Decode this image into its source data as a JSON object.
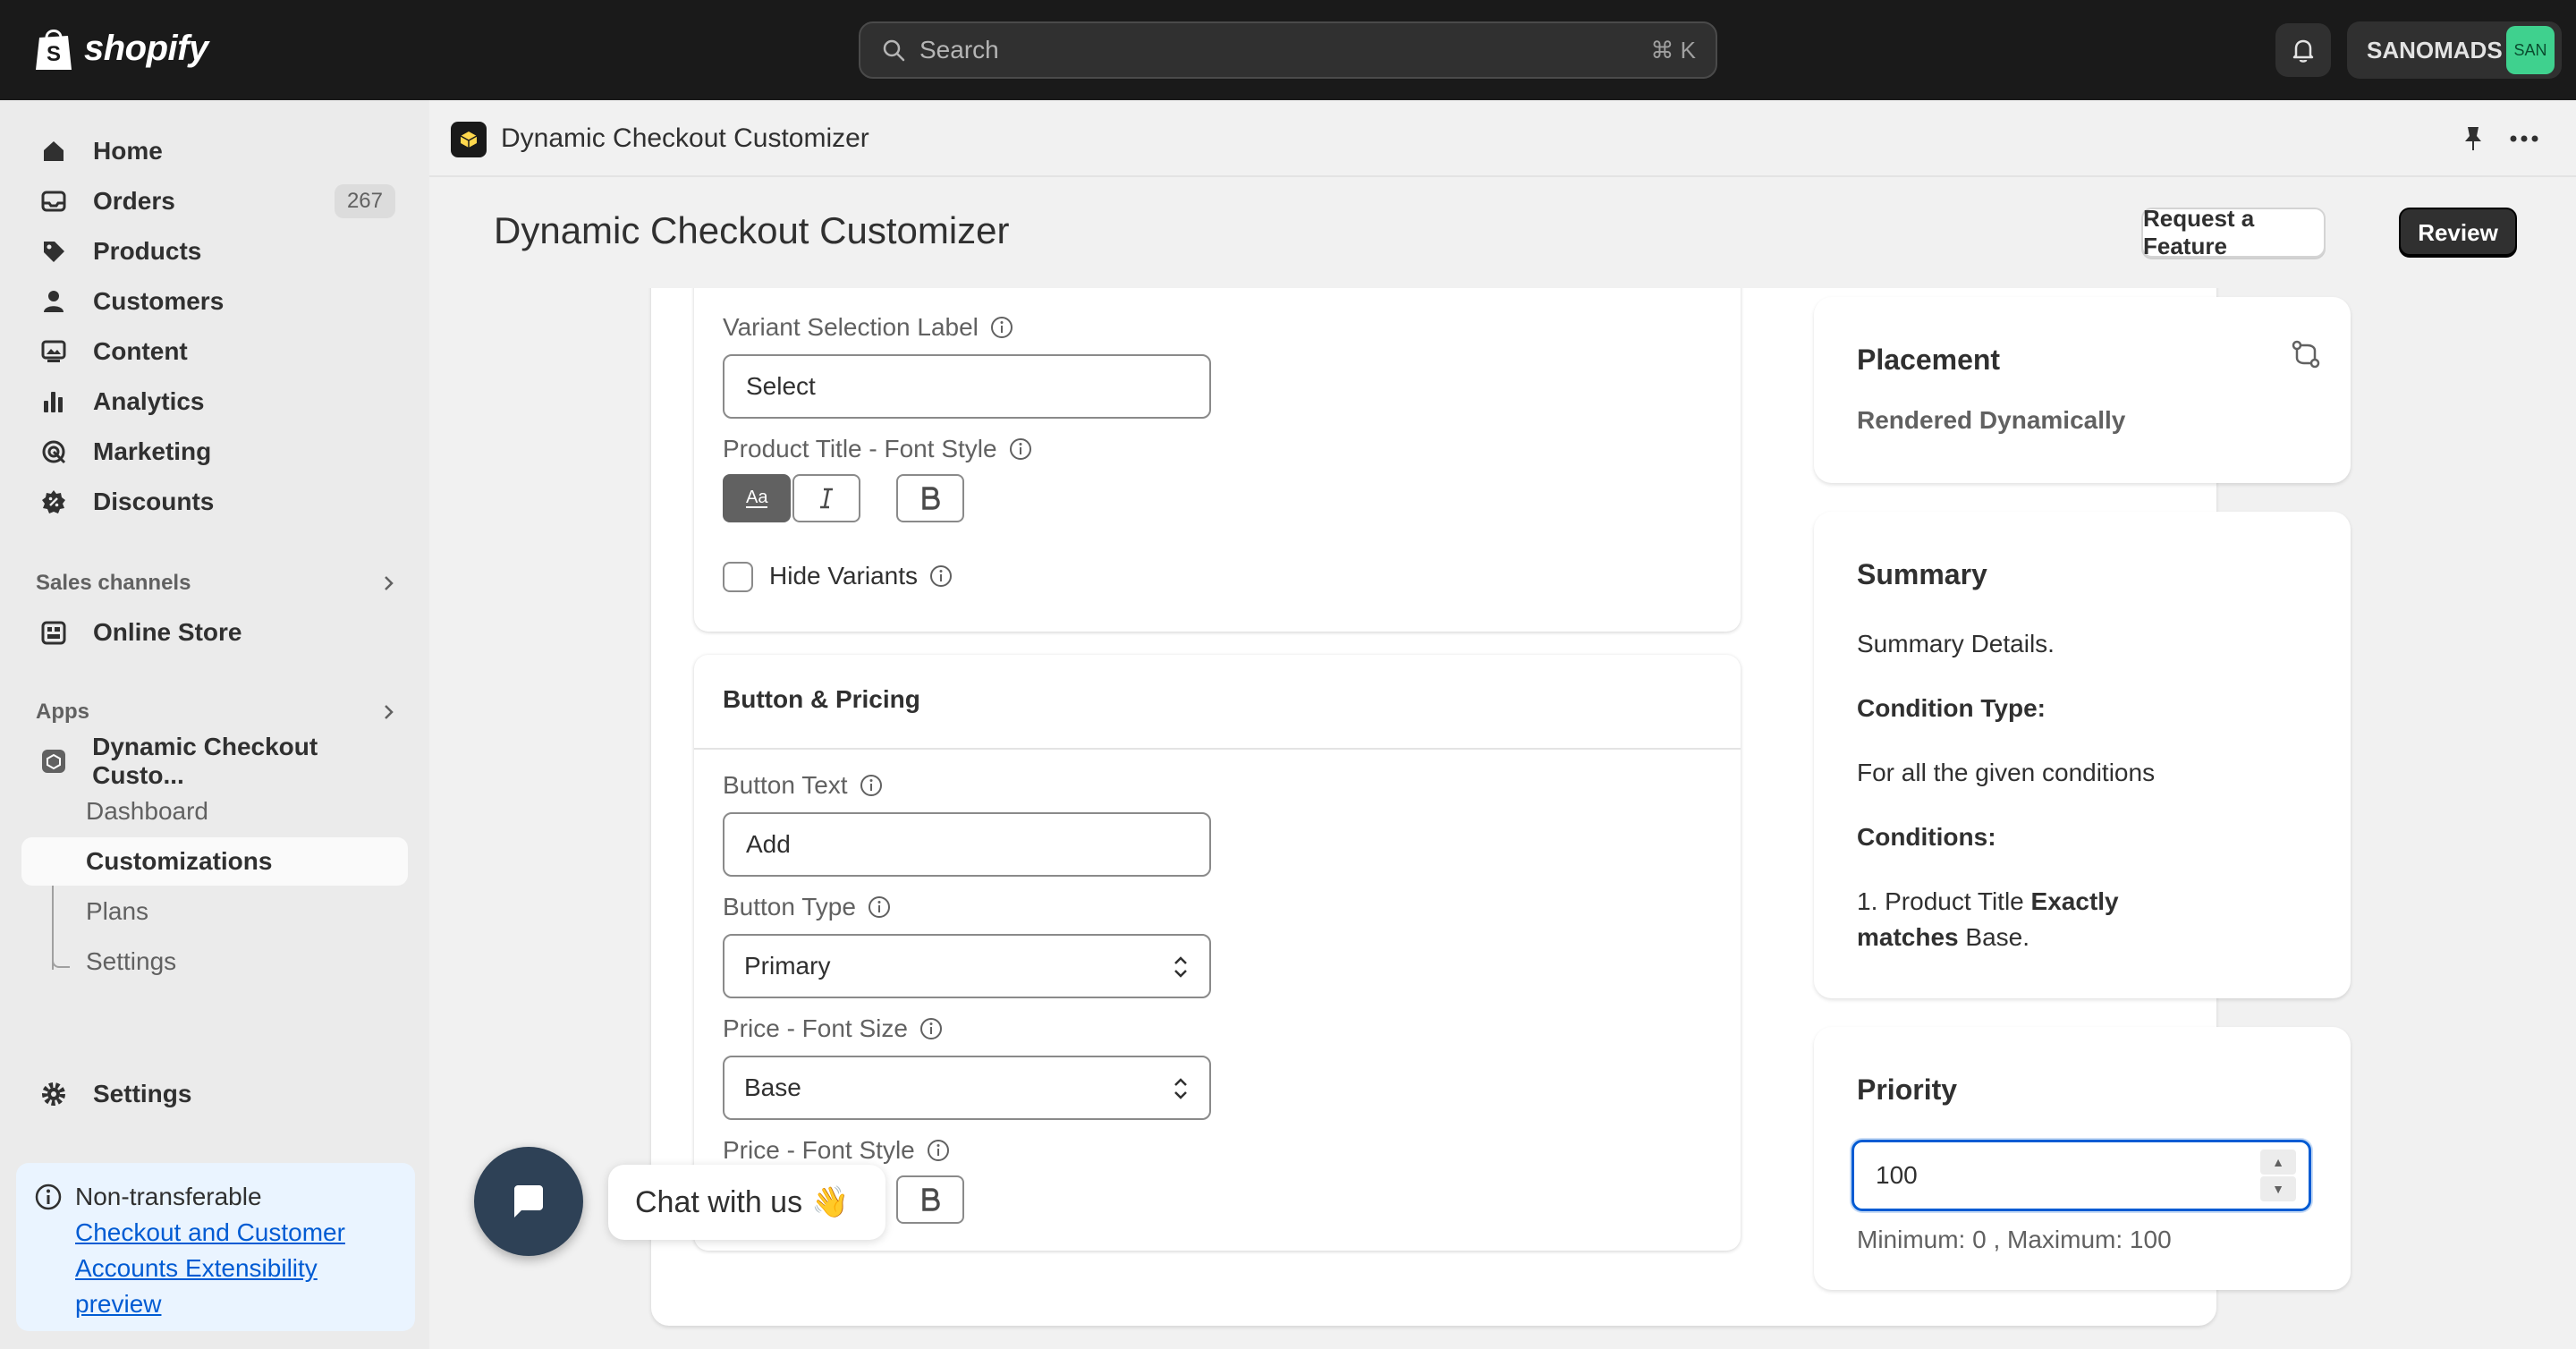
{
  "topbar": {
    "logo_text": "shopify",
    "search_placeholder": "Search",
    "search_shortcut": "⌘ K",
    "store_name": "SANOMADS",
    "avatar_initials": "SAN"
  },
  "sidebar": {
    "items": [
      {
        "label": "Home",
        "icon": "home-icon"
      },
      {
        "label": "Orders",
        "icon": "inbox-icon",
        "badge": "267"
      },
      {
        "label": "Products",
        "icon": "tag-icon"
      },
      {
        "label": "Customers",
        "icon": "person-icon"
      },
      {
        "label": "Content",
        "icon": "image-icon"
      },
      {
        "label": "Analytics",
        "icon": "bar-chart-icon"
      },
      {
        "label": "Marketing",
        "icon": "target-icon"
      },
      {
        "label": "Discounts",
        "icon": "discount-icon"
      }
    ],
    "sales_channels_label": "Sales channels",
    "online_store_label": "Online Store",
    "apps_label": "Apps",
    "app_name": "Dynamic Checkout Custo...",
    "app_subitems": [
      "Dashboard",
      "Customizations",
      "Plans",
      "Settings"
    ],
    "settings_label": "Settings",
    "notice": {
      "title": "Non-transferable",
      "link": "Checkout and Customer Accounts Extensibility preview"
    }
  },
  "appbar": {
    "title": "Dynamic Checkout Customizer"
  },
  "page": {
    "title": "Dynamic Checkout Customizer",
    "request_button": "Request a Feature",
    "review_button": "Review"
  },
  "card1": {
    "variant_label": "Variant Selection Label",
    "variant_value": "Select",
    "title_font_style_label": "Product Title - Font Style",
    "hide_variants_label": "Hide Variants"
  },
  "card2": {
    "heading": "Button & Pricing",
    "button_text_label": "Button Text",
    "button_text_value": "Add",
    "button_type_label": "Button Type",
    "button_type_value": "Primary",
    "price_font_size_label": "Price - Font Size",
    "price_font_size_value": "Base",
    "price_font_style_label": "Price - Font Style"
  },
  "placement": {
    "title": "Placement",
    "value": "Rendered Dynamically"
  },
  "summary": {
    "title": "Summary",
    "details": "Summary Details.",
    "condition_type_label": "Condition Type:",
    "condition_type_value": "For all the given conditions",
    "conditions_label": "Conditions:",
    "condition_prefix": "1. Product Title ",
    "condition_bold": "Exactly matches",
    "condition_suffix": " Base."
  },
  "priority": {
    "title": "Priority",
    "value": "100",
    "help": "Minimum: 0 , Maximum: 100"
  },
  "chat": {
    "label": "Chat with us",
    "emoji": "👋"
  },
  "colors": {
    "topbar": "#1a1a1a",
    "accent_blue": "#005bd3",
    "avatar": "#3fd18e"
  }
}
